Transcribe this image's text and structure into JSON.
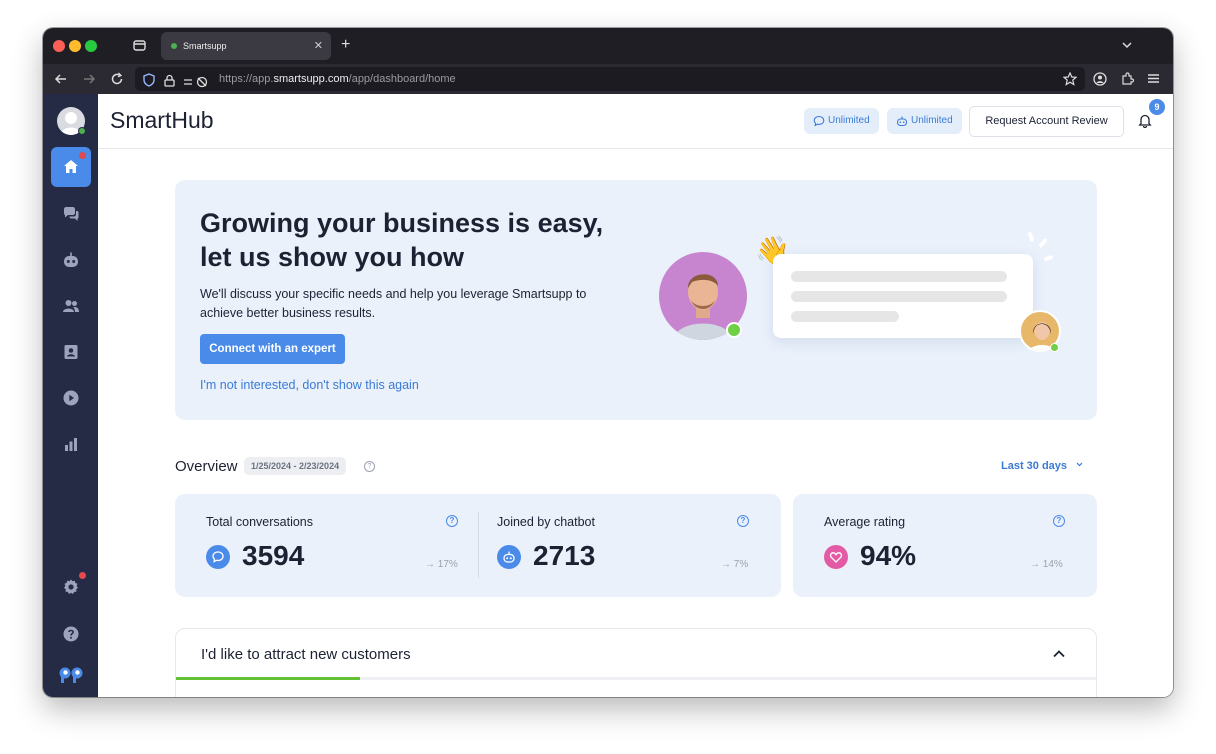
{
  "browser": {
    "tab_title": "Smartsupp",
    "url_prefix": "https://app.",
    "url_domain": "smartsupp.com",
    "url_path": "/app/dashboard/home"
  },
  "sidebar": {
    "items": [
      {
        "icon": "home-icon",
        "active": true,
        "notification": true
      },
      {
        "icon": "chat-icon"
      },
      {
        "icon": "bot-icon"
      },
      {
        "icon": "users-icon"
      },
      {
        "icon": "contacts-icon"
      },
      {
        "icon": "play-icon"
      },
      {
        "icon": "stats-icon"
      }
    ],
    "bottom": [
      {
        "icon": "gear-icon",
        "notification": true
      },
      {
        "icon": "help-icon"
      }
    ]
  },
  "header": {
    "title": "SmartHub",
    "pill_conversations": "Unlimited",
    "pill_bots": "Unlimited",
    "request_button": "Request Account Review",
    "notification_count": "9"
  },
  "hero": {
    "title": "Growing your business is easy, let us show you how",
    "description": "We'll discuss your specific needs and help you leverage Smartsupp to achieve better business results.",
    "cta": "Connect with an expert",
    "dismiss": "I'm not interested, don't show this again"
  },
  "overview": {
    "title": "Overview",
    "date_range": "1/25/2024 - 2/23/2024",
    "period": "Last 30 days",
    "stats": [
      {
        "label": "Total conversations",
        "value": "3594",
        "trend": "17%",
        "icon": "chat-bubble-icon",
        "color": "#4a8ae8"
      },
      {
        "label": "Joined by chatbot",
        "value": "2713",
        "trend": "7%",
        "icon": "bot-icon",
        "color": "#4a8ae8"
      },
      {
        "label": "Average rating",
        "value": "94%",
        "trend": "14%",
        "icon": "heart-icon",
        "color": "#e35ba4"
      }
    ]
  },
  "goal": {
    "title": "I'd like to attract new customers",
    "progress": 0.2
  }
}
